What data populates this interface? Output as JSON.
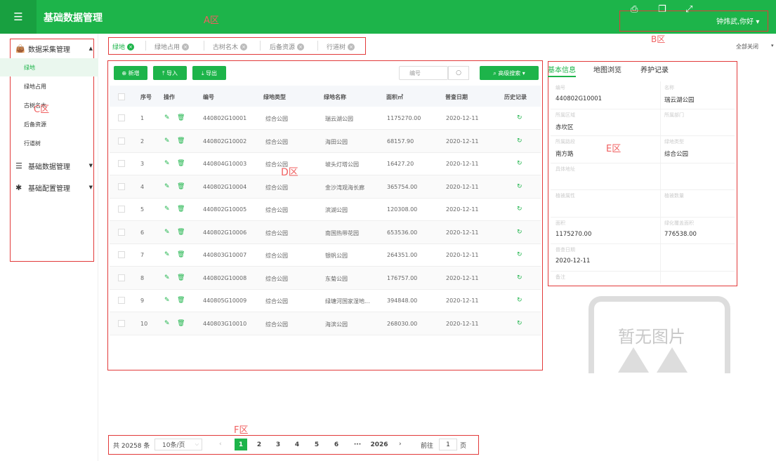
{
  "header": {
    "title": "基础数据管理",
    "zone_label": "A区",
    "zone_b_label": "B区",
    "user": "钟炜武,你好 ▾",
    "tools": [
      "print-icon",
      "copy-icon",
      "fullscreen-icon"
    ]
  },
  "sidebar": {
    "zone_label": "C区",
    "groups": [
      {
        "label": "数据采集管理",
        "icon": "bag-icon",
        "expanded": true
      },
      {
        "label": "基础数据管理",
        "icon": "database-icon",
        "expanded": false
      },
      {
        "label": "基础配置管理",
        "icon": "puzzle-icon",
        "expanded": false
      }
    ],
    "items": [
      "绿地",
      "绿地占用",
      "古树名木",
      "后备资源",
      "行道树"
    ]
  },
  "tabs": {
    "items": [
      "绿地",
      "绿地占用",
      "古树名木",
      "后备资源",
      "行道树"
    ],
    "close_all": "全部关闭"
  },
  "toolbar": {
    "add": "⊕ 新增",
    "import": "⤒ 导入",
    "export": "⤓ 导出",
    "search_placeholder": "编号",
    "advanced": "⌕ 高级搜索 ▾"
  },
  "table": {
    "zone_label": "D区",
    "headers": [
      "序号",
      "操作",
      "编号",
      "绿地类型",
      "绿地名称",
      "面积㎡",
      "普查日期",
      "历史记录"
    ],
    "rows": [
      {
        "idx": "1",
        "code": "440802G10001",
        "type": "综合公园",
        "name": "瑞云湖公园",
        "area": "1175270.00",
        "date": "2020-12-11"
      },
      {
        "idx": "2",
        "code": "440802G10002",
        "type": "综合公园",
        "name": "海田公园",
        "area": "68157.90",
        "date": "2020-12-11"
      },
      {
        "idx": "3",
        "code": "440804G10003",
        "type": "综合公园",
        "name": "坡头灯塔公园",
        "area": "16427.20",
        "date": "2020-12-11"
      },
      {
        "idx": "4",
        "code": "440802G10004",
        "type": "综合公园",
        "name": "金沙湾观海长廊",
        "area": "365754.00",
        "date": "2020-12-11"
      },
      {
        "idx": "5",
        "code": "440802G10005",
        "type": "综合公园",
        "name": "滨湖公园",
        "area": "120308.00",
        "date": "2020-12-11"
      },
      {
        "idx": "6",
        "code": "440802G10006",
        "type": "综合公园",
        "name": "南国热带花园",
        "area": "653536.00",
        "date": "2020-12-11"
      },
      {
        "idx": "7",
        "code": "440803G10007",
        "type": "综合公园",
        "name": "银帆公园",
        "area": "264351.00",
        "date": "2020-12-11"
      },
      {
        "idx": "8",
        "code": "440802G10008",
        "type": "综合公园",
        "name": "东菊公园",
        "area": "176757.00",
        "date": "2020-12-11"
      },
      {
        "idx": "9",
        "code": "440805G10009",
        "type": "综合公园",
        "name": "绿塘河国家湿地...",
        "area": "394848.00",
        "date": "2020-12-11"
      },
      {
        "idx": "10",
        "code": "440803G10010",
        "type": "综合公园",
        "name": "海滨公园",
        "area": "268030.00",
        "date": "2020-12-11"
      }
    ]
  },
  "detail": {
    "zone_label": "E区",
    "tabs": [
      "基本信息",
      "地图浏览",
      "养护记录"
    ],
    "fields": [
      {
        "label": "编号",
        "value": "440802G10001"
      },
      {
        "label": "名称",
        "value": "瑞云湖公园"
      },
      {
        "label": "所属区域",
        "value": "赤坎区"
      },
      {
        "label": "所属部门",
        "value": ""
      },
      {
        "label": "所属路段",
        "value": "南方路"
      },
      {
        "label": "绿地类型",
        "value": "综合公园"
      },
      {
        "label": "具体地址",
        "value": ""
      },
      {
        "label": "",
        "value": ""
      },
      {
        "label": "植被属性",
        "value": ""
      },
      {
        "label": "植被数量",
        "value": ""
      },
      {
        "label": "面积",
        "value": "1175270.00"
      },
      {
        "label": "绿化覆盖面积",
        "value": "776538.00"
      },
      {
        "label": "普查日期",
        "value": "2020-12-11"
      },
      {
        "label": "",
        "value": ""
      },
      {
        "label": "备注",
        "value": ""
      }
    ],
    "no_image": "暂无图片"
  },
  "pager": {
    "zone_label": "F区",
    "total": "共 20258 条",
    "page_size": "10条/页",
    "pages": [
      "1",
      "2",
      "3",
      "4",
      "5",
      "6",
      "···",
      "2026"
    ],
    "goto_prefix": "前往",
    "goto_value": "1",
    "goto_suffix": "页",
    "prev": "‹",
    "next": "›"
  },
  "colors": {
    "brand": "#1db44a",
    "annotation": "#e23a3a"
  }
}
